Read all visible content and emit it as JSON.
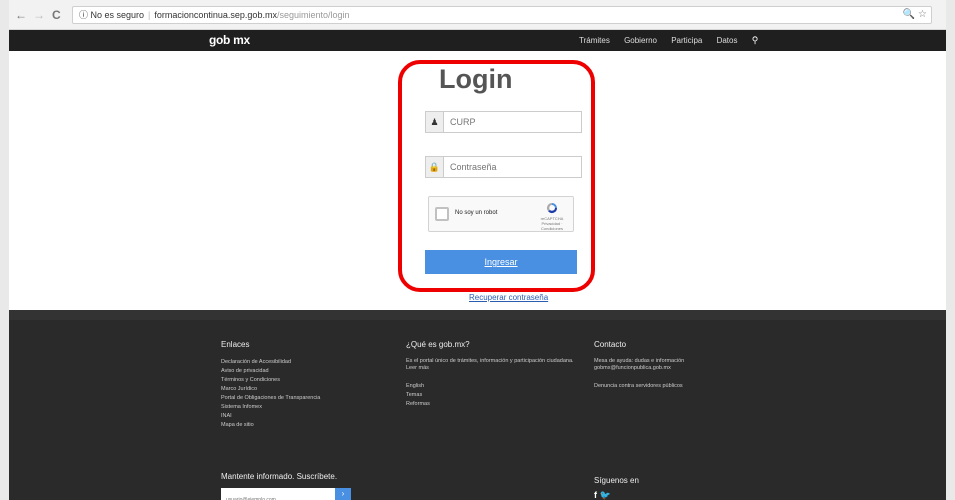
{
  "browser": {
    "back_icon": "←",
    "forward_icon": "→",
    "reload_icon": "C",
    "security": "ⓘ No es seguro",
    "domain": "formacioncontinua.sep.gob.mx",
    "path": "/seguimiento/login",
    "right_icons": "🔍 ☆"
  },
  "header": {
    "logo": "gob mx",
    "nav": [
      "Trámites",
      "Gobierno",
      "Participa",
      "Datos"
    ],
    "search_icon": "🔍"
  },
  "login": {
    "title": "Login",
    "curp_placeholder": "CURP",
    "password_placeholder": "Contraseña",
    "captcha_label": "No soy un robot",
    "captcha_brand": "reCAPTCHA",
    "captcha_links": "Privacidad · Condiciones",
    "submit": "Ingresar",
    "recover": "Recuperar contraseña",
    "highlight_color": "#e00000",
    "button_color": "#4a90e2"
  },
  "footer": {
    "links_title": "Enlaces",
    "links": [
      "Declaración de Accesibilidad",
      "Aviso de privacidad",
      "Términos y Condiciones",
      "Marco Jurídico",
      "Portal de Obligaciones de Transparencia",
      "Sistema Infomex",
      "INAI",
      "Mapa de sitio"
    ],
    "what_title": "¿Qué es gob.mx?",
    "what_text": "Es el portal único de trámites, información y participación ciudadana. Leer más",
    "what_links": [
      "English",
      "Temas",
      "Reformas"
    ],
    "contact_title": "Contacto",
    "contact_text": "Mesa de ayuda: dudas e información gobmx@funcionpublica.gob.mx",
    "contact_link": "Denuncia contra servidores públicos",
    "subscribe": "Mantente informado. Suscríbete.",
    "email_placeholder": "usuario@ejemplo.com",
    "follow": "Síguenos en",
    "social": "f  🐦"
  }
}
